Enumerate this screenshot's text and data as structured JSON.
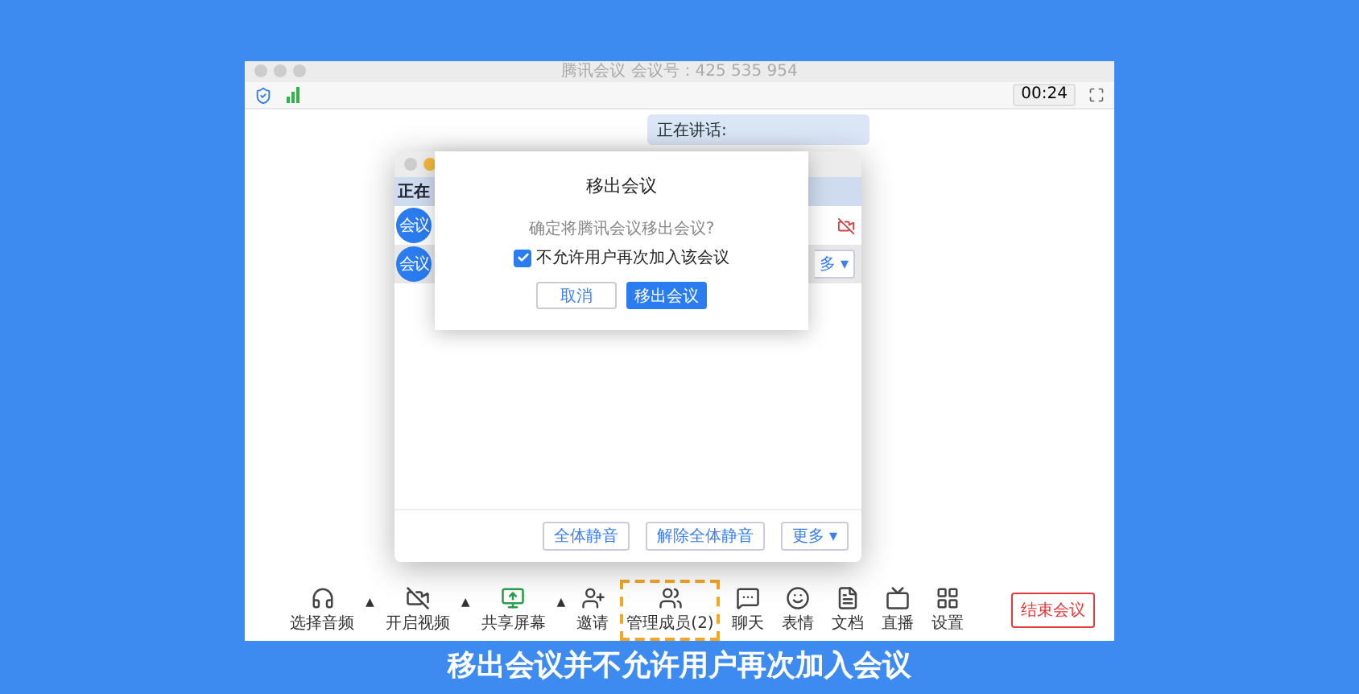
{
  "window": {
    "title": "腾讯会议 会议号：425 535 954"
  },
  "top_bar": {
    "timer": "00:24"
  },
  "speaker_banner": {
    "text": "正在讲话:"
  },
  "members_panel": {
    "header": "正在",
    "rows": [
      {
        "avatar": "会议",
        "video_off": true,
        "selected": false
      },
      {
        "avatar": "会议",
        "video_off": false,
        "selected": true,
        "more": "多 ▾"
      }
    ],
    "footer_buttons": [
      "全体静音",
      "解除全体静音",
      "更多 ▾"
    ]
  },
  "dialog": {
    "title": "移出会议",
    "question": "确定将腾讯会议移出会议?",
    "checkbox": {
      "label": "不允许用户再次加入该会议",
      "checked": true
    },
    "cancel": "取消",
    "confirm": "移出会议"
  },
  "toolbar": {
    "items": [
      {
        "kind": "audio",
        "label": "选择音频",
        "caret": "▲",
        "highlighted": false
      },
      {
        "kind": "video",
        "label": "开启视频",
        "caret": "▲",
        "highlighted": false
      },
      {
        "kind": "share",
        "label": "共享屏幕",
        "caret": "▲",
        "highlighted": false
      },
      {
        "kind": "invite",
        "label": "邀请",
        "highlighted": false
      },
      {
        "kind": "members",
        "label": "管理成员(2)",
        "highlighted": true
      },
      {
        "kind": "chat",
        "label": "聊天",
        "highlighted": false
      },
      {
        "kind": "emoji",
        "label": "表情",
        "highlighted": false
      },
      {
        "kind": "docs",
        "label": "文档",
        "highlighted": false
      },
      {
        "kind": "live",
        "label": "直播",
        "highlighted": false
      },
      {
        "kind": "settings",
        "label": "设置",
        "highlighted": false
      }
    ],
    "end_button": "结束会议"
  },
  "caption": "移出会议并不允许用户再次加入会议"
}
